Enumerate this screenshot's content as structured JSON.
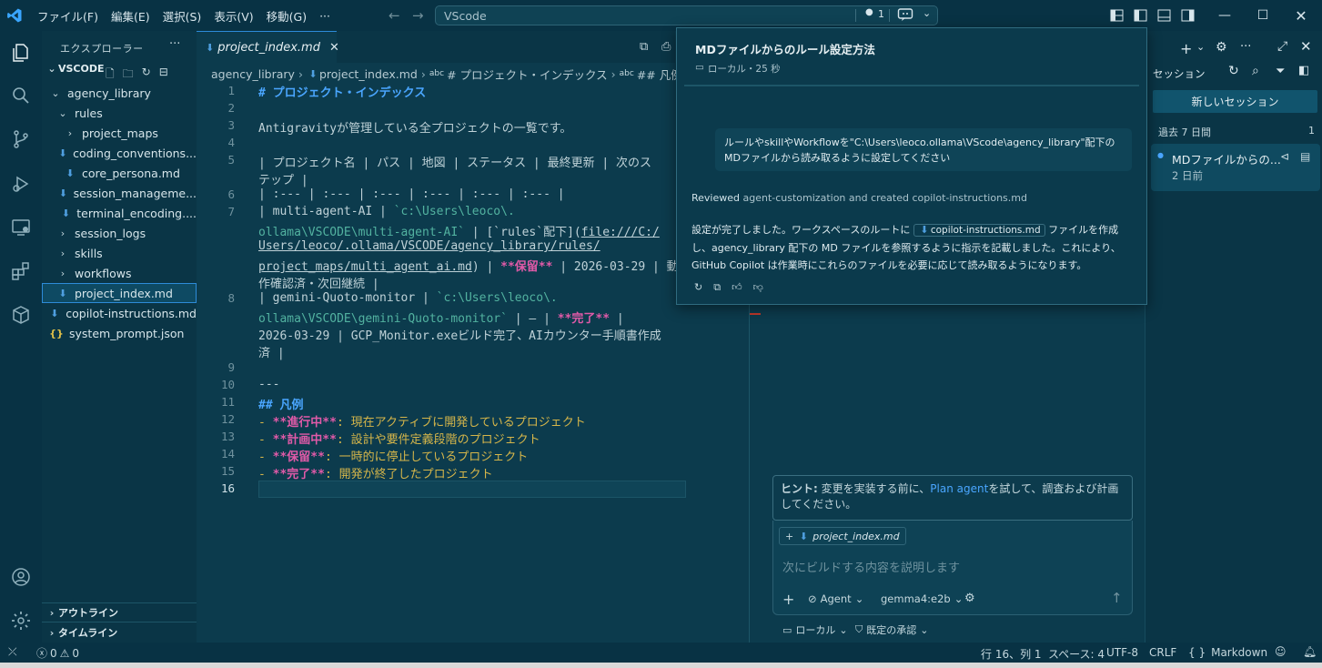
{
  "titlebar": {
    "menus": [
      "ファイル(F)",
      "編集(E)",
      "選択(S)",
      "表示(V)",
      "移動(G)",
      "···"
    ],
    "search": "VScode",
    "notif_count": "1"
  },
  "sidebar": {
    "header": "エクスプローラー",
    "root": "VSCODE",
    "tree": [
      {
        "label": "agency_library",
        "depth": 1,
        "kind": "folder-open"
      },
      {
        "label": "rules",
        "depth": 2,
        "kind": "folder-open"
      },
      {
        "label": "project_maps",
        "depth": 3,
        "kind": "folder"
      },
      {
        "label": "coding_conventions...",
        "depth": 3,
        "kind": "md"
      },
      {
        "label": "core_persona.md",
        "depth": 3,
        "kind": "md"
      },
      {
        "label": "session_manageme...",
        "depth": 3,
        "kind": "md"
      },
      {
        "label": "terminal_encoding....",
        "depth": 3,
        "kind": "md"
      },
      {
        "label": "session_logs",
        "depth": 2,
        "kind": "folder"
      },
      {
        "label": "skills",
        "depth": 2,
        "kind": "folder"
      },
      {
        "label": "workflows",
        "depth": 2,
        "kind": "folder"
      },
      {
        "label": "project_index.md",
        "depth": 2,
        "kind": "md",
        "selected": true
      },
      {
        "label": "copilot-instructions.md",
        "depth": 1,
        "kind": "md"
      },
      {
        "label": "system_prompt.json",
        "depth": 1,
        "kind": "json"
      }
    ],
    "outline": "アウトライン",
    "timeline": "タイムライン"
  },
  "editor": {
    "tab": "project_index.md",
    "breadcrumb": [
      "agency_library",
      "project_index.md",
      "# プロジェクト・インデックス",
      "## 凡例"
    ],
    "line_numbers": [
      "1",
      "2",
      "3",
      "4",
      "5",
      "6",
      "7",
      "8",
      "9",
      "10",
      "11",
      "12",
      "13",
      "14",
      "15",
      "16"
    ],
    "lines": {
      "l1": "# プロジェクト・インデックス",
      "l3": "Antigravityが管理している全プロジェクトの一覧です。",
      "l5a": "| プロジェクト名 | パス | 地図 | ステータス | 最終更新 | 次のス",
      "l5b": "テップ |",
      "l6": "| :--- | :--- | :--- | :--- | :--- | :--- |",
      "l7a1": "| multi-agent-AI | ",
      "l7a2": "`c:\\Users\\leoco\\.",
      "l7b1": "ollama\\VSCODE\\multi-agent-AI`",
      "l7b2": " | [`rules`配下](",
      "l7b3": "file:///C:/",
      "l7c": "Users/leoco/.ollama/VSCODE/agency_library/rules/",
      "l7d1": "project_maps/multi_agent_ai.md",
      "l7d2": ") | ",
      "l7d3": "**保留**",
      "l7d4": " | 2026-03-29 | 動",
      "l7e": "作確認済・次回継続 |",
      "l8a1": "| gemini-Quoto-monitor | ",
      "l8a2": "`c:\\Users\\leoco\\.",
      "l8b1": "ollama\\VSCODE\\gemini-Quoto-monitor`",
      "l8b2": " | — | ",
      "l8b3": "**完了**",
      "l8b4": " |",
      "l8c": "2026-03-29 | GCP_Monitor.exeビルド完了、AIカウンター手順書作成",
      "l8d": "済 |",
      "l10": "---",
      "l11": "## 凡例",
      "l12a": "**進行中**",
      "l12b": ": 現在アクティブに開発しているプロジェクト",
      "l13a": "**計画中**",
      "l13b": ": 設計や要件定義段階のプロジェクト",
      "l14a": "**保留**",
      "l14b": ": 一時的に停止しているプロジェクト",
      "l15a": "**完了**",
      "l15b": ": 開発が終了したプロジェクト",
      "dash": "- "
    }
  },
  "popup": {
    "title": "MDファイルからのルール設定方法",
    "meta": "ローカル・25 秒",
    "user_message": "ルールやskillやWorkflowを\"C:\\Users\\leoco.ollama\\VScode\\agency_library\"配下のMDファイルから読み取るように設定してください",
    "reviewed_label": "Reviewed",
    "reviewed_text": "agent-customization and created copilot-instructions.md",
    "reply_pre": "設定が完了しました。ワークスペースのルートに",
    "reply_chip": "copilot-instructions.md",
    "reply_post": "ファイルを作成し、agency_library 配下の MD ファイルを参照するように指示を記載しました。これにより、GitHub Copilot は作業時にこれらのファイルを必要に応じて読み取るようになります。"
  },
  "chat": {
    "hint_label": "ヒント:",
    "hint_pre": "変更を実装する前に、",
    "hint_link": "Plan agent",
    "hint_post": "を試して、調査および計画してください。",
    "attachment": "project_index.md",
    "placeholder": "次にビルドする内容を説明します",
    "agent": "Agent",
    "model": "gemma4:e2b",
    "location": "ローカル",
    "approval": "既定の承認"
  },
  "sessions": {
    "header": "セッション",
    "new_button": "新しいセッション",
    "group_label": "過去 7 日間",
    "group_count": "1",
    "item_title": "MDファイルからの...",
    "item_time": "2 日前"
  },
  "statusbar": {
    "errors": "0",
    "warnings": "0",
    "position": "行 16、列 1",
    "spaces": "スペース: 4",
    "encoding": "UTF-8",
    "eol": "CRLF",
    "language": "Markdown"
  },
  "colors": {
    "accent": "#2d8bd8",
    "bg": "#0c3b4d",
    "pink": "#e05aa8",
    "string": "#52b2a0",
    "list": "#d6b64a"
  }
}
